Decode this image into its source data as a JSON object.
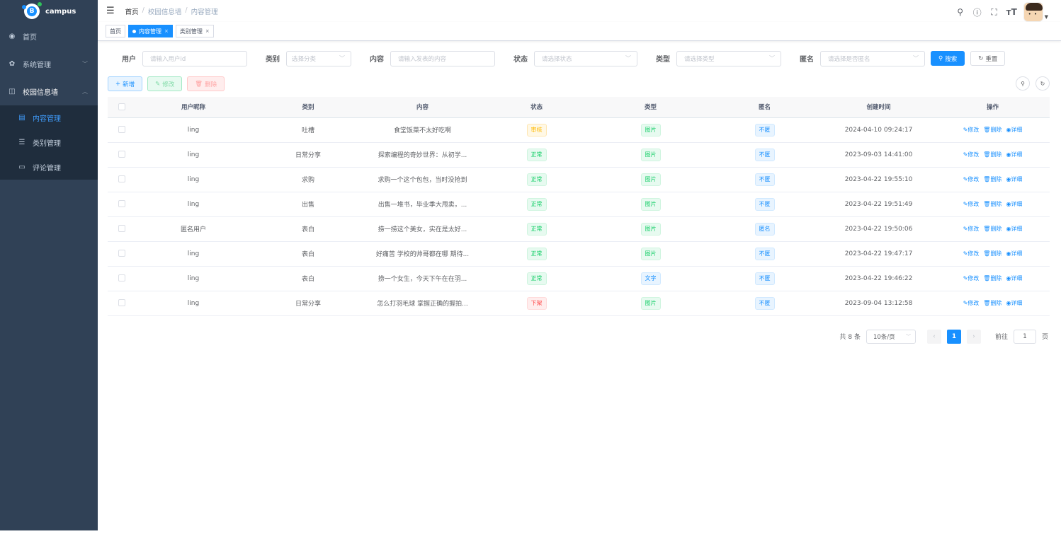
{
  "app": {
    "name": "campus"
  },
  "sidebar": {
    "items": [
      {
        "label": "首页",
        "icon": "dashboard-icon"
      },
      {
        "label": "系统管理",
        "icon": "gear-icon"
      },
      {
        "label": "校园信息墙",
        "icon": "book-icon"
      }
    ],
    "sub_items": [
      {
        "label": "内容管理",
        "icon": "document-icon",
        "active": true
      },
      {
        "label": "类别管理",
        "icon": "list-icon"
      },
      {
        "label": "评论管理",
        "icon": "comment-icon"
      }
    ]
  },
  "breadcrumb": [
    "首页",
    "校园信息墙",
    "内容管理"
  ],
  "tags": [
    {
      "label": "首页"
    },
    {
      "label": "内容管理",
      "active": true
    },
    {
      "label": "类别管理"
    }
  ],
  "search": {
    "user_label": "用户",
    "user_placeholder": "请输入用户id",
    "category_label": "类别",
    "category_placeholder": "选择分类",
    "content_label": "内容",
    "content_placeholder": "请输入发表的内容",
    "status_label": "状态",
    "status_placeholder": "请选择状态",
    "type_label": "类型",
    "type_placeholder": "请选择类型",
    "anon_label": "匿名",
    "anon_placeholder": "请选择是否匿名",
    "search_btn": "搜索",
    "reset_btn": "重置"
  },
  "toolbar": {
    "add": "新增",
    "edit": "修改",
    "delete": "删除"
  },
  "table": {
    "headers": [
      "用户昵称",
      "类别",
      "内容",
      "状态",
      "类型",
      "匿名",
      "创建时间",
      "操作"
    ],
    "actions": {
      "edit": "修改",
      "delete": "删除",
      "detail": "详细"
    },
    "rows": [
      {
        "user": "ling",
        "category": "吐槽",
        "content": "食堂饭菜不太好吃啊",
        "status": "审核",
        "status_type": "warning",
        "type": "图片",
        "type_style": "success",
        "anon": "不匿",
        "time": "2024-04-10 09:24:17"
      },
      {
        "user": "ling",
        "category": "日常分享",
        "content": "探索编程的奇妙世界：从初学...",
        "status": "正常",
        "status_type": "success",
        "type": "图片",
        "type_style": "success",
        "anon": "不匿",
        "time": "2023-09-03 14:41:00"
      },
      {
        "user": "ling",
        "category": "求购",
        "content": "求购一个这个包包，当时没抢到",
        "status": "正常",
        "status_type": "success",
        "type": "图片",
        "type_style": "success",
        "anon": "不匿",
        "time": "2023-04-22 19:55:10"
      },
      {
        "user": "ling",
        "category": "出售",
        "content": "出售一堆书，毕业季大甩卖，...",
        "status": "正常",
        "status_type": "success",
        "type": "图片",
        "type_style": "success",
        "anon": "不匿",
        "time": "2023-04-22 19:51:49"
      },
      {
        "user": "匿名用户",
        "category": "表白",
        "content": "捞一捞这个美女，实在是太好...",
        "status": "正常",
        "status_type": "success",
        "type": "图片",
        "type_style": "success",
        "anon": "匿名",
        "time": "2023-04-22 19:50:06"
      },
      {
        "user": "ling",
        "category": "表白",
        "content": "好痛苦 学校的帅哥都在哪 期待...",
        "status": "正常",
        "status_type": "success",
        "type": "图片",
        "type_style": "success",
        "anon": "不匿",
        "time": "2023-04-22 19:47:17"
      },
      {
        "user": "ling",
        "category": "表白",
        "content": "捞一个女生，今天下午在在羽...",
        "status": "正常",
        "status_type": "success",
        "type": "文字",
        "type_style": "info",
        "anon": "不匿",
        "time": "2023-04-22 19:46:22"
      },
      {
        "user": "ling",
        "category": "日常分享",
        "content": "怎么打羽毛球 掌握正确的握拍...",
        "status": "下架",
        "status_type": "danger",
        "type": "图片",
        "type_style": "success",
        "anon": "不匿",
        "time": "2023-09-04 13:12:58"
      }
    ]
  },
  "pagination": {
    "total": "共 8 条",
    "page_size": "10条/页",
    "current": "1",
    "goto_label": "前往",
    "goto_value": "1",
    "page_suffix": "页"
  }
}
